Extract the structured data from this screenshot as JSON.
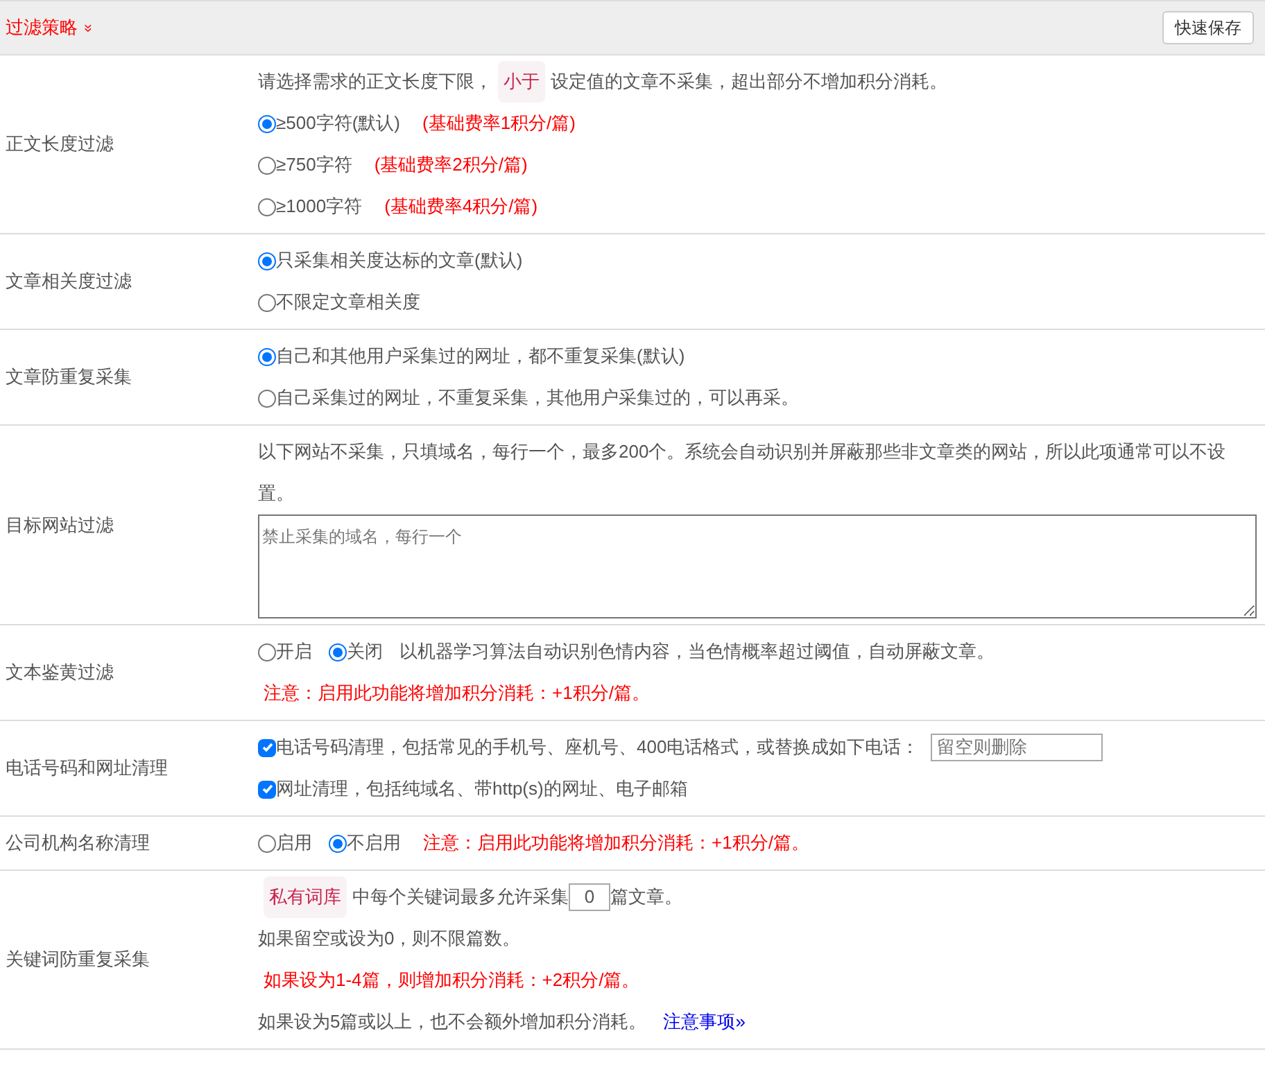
{
  "header": {
    "title": "过滤策略",
    "toggle": "»",
    "save_button": "快速保存"
  },
  "rows": [
    {
      "label": "正文长度过滤",
      "lines": [
        [
          {
            "kind": "text",
            "text": "请选择需求的正文长度下限，"
          },
          {
            "kind": "tag",
            "text": "小于"
          },
          {
            "kind": "text",
            "text": "设定值的文章不采集，超出部分不增加积分消耗。"
          }
        ],
        [
          {
            "kind": "radio",
            "text": "≥500字符(默认)",
            "selected": true
          },
          {
            "kind": "note",
            "text": "(基础费率1积分/篇)"
          }
        ],
        [
          {
            "kind": "radio",
            "text": "≥750字符",
            "selected": false
          },
          {
            "kind": "note",
            "text": "(基础费率2积分/篇)"
          }
        ],
        [
          {
            "kind": "radio",
            "text": "≥1000字符",
            "selected": false
          },
          {
            "kind": "note",
            "text": "(基础费率4积分/篇)"
          }
        ]
      ]
    },
    {
      "label": "文章相关度过滤",
      "lines": [
        [
          {
            "kind": "radio",
            "text": "只采集相关度达标的文章(默认)",
            "selected": true
          }
        ],
        [
          {
            "kind": "radio",
            "text": "不限定文章相关度",
            "selected": false
          }
        ]
      ]
    },
    {
      "label": "文章防重复采集",
      "lines": [
        [
          {
            "kind": "radio",
            "text": "自己和其他用户采集过的网址，都不重复采集(默认)",
            "selected": true
          }
        ],
        [
          {
            "kind": "radio",
            "text": "自己采集过的网址，不重复采集，其他用户采集过的，可以再采。",
            "selected": false
          }
        ]
      ]
    },
    {
      "label": "目标网站过滤",
      "lines": [
        [
          {
            "kind": "text",
            "text": "以下网站不采集，只填域名，每行一个，最多200个。系统会自动识别并屏蔽那些非文章类的网站，所以此项通常可以不设置。"
          }
        ],
        [
          {
            "kind": "textarea",
            "placeholder": "禁止采集的域名，每行一个"
          }
        ]
      ]
    },
    {
      "label": "文本鉴黄过滤",
      "lines": [
        [
          {
            "kind": "radio",
            "text": "开启",
            "selected": false
          },
          {
            "kind": "radio",
            "text": "关闭",
            "selected": true
          },
          {
            "kind": "text",
            "text": "以机器学习算法自动识别色情内容，当色情概率超过阈值，自动屏蔽文章。"
          }
        ],
        [
          {
            "kind": "note",
            "text": "注意：启用此功能将增加积分消耗：+1积分/篇。"
          }
        ]
      ]
    },
    {
      "label": "电话号码和网址清理",
      "lines": [
        [
          {
            "kind": "checkbox",
            "text": "电话号码清理，包括常见的手机号、座机号、400电话格式，或替换成如下电话：",
            "checked": true
          },
          {
            "kind": "input",
            "placeholder": "留空则删除"
          }
        ],
        [
          {
            "kind": "checkbox",
            "text": "网址清理，包括纯域名、带http(s)的网址、电子邮箱",
            "checked": true
          }
        ]
      ]
    },
    {
      "label": "公司机构名称清理",
      "lines": [
        [
          {
            "kind": "radio",
            "text": "启用",
            "selected": false
          },
          {
            "kind": "radio",
            "text": "不启用",
            "selected": true
          },
          {
            "kind": "note",
            "text": "注意：启用此功能将增加积分消耗：+1积分/篇。"
          }
        ]
      ]
    },
    {
      "label": "关键词防重复采集",
      "lines": [
        [
          {
            "kind": "tag",
            "text": "私有词库"
          },
          {
            "kind": "text",
            "text": "中每个关键词最多允许采集"
          },
          {
            "kind": "number",
            "value": "0"
          },
          {
            "kind": "text",
            "text": "篇文章。"
          }
        ],
        [
          {
            "kind": "text",
            "text": "如果留空或设为0，则不限篇数。"
          }
        ],
        [
          {
            "kind": "note",
            "text": "如果设为1-4篇，则增加积分消耗：+2积分/篇。"
          }
        ],
        [
          {
            "kind": "text",
            "text": "如果设为5篇或以上，也不会额外增加积分消耗。"
          },
          {
            "kind": "link",
            "text": "注意事项»"
          }
        ]
      ]
    }
  ]
}
